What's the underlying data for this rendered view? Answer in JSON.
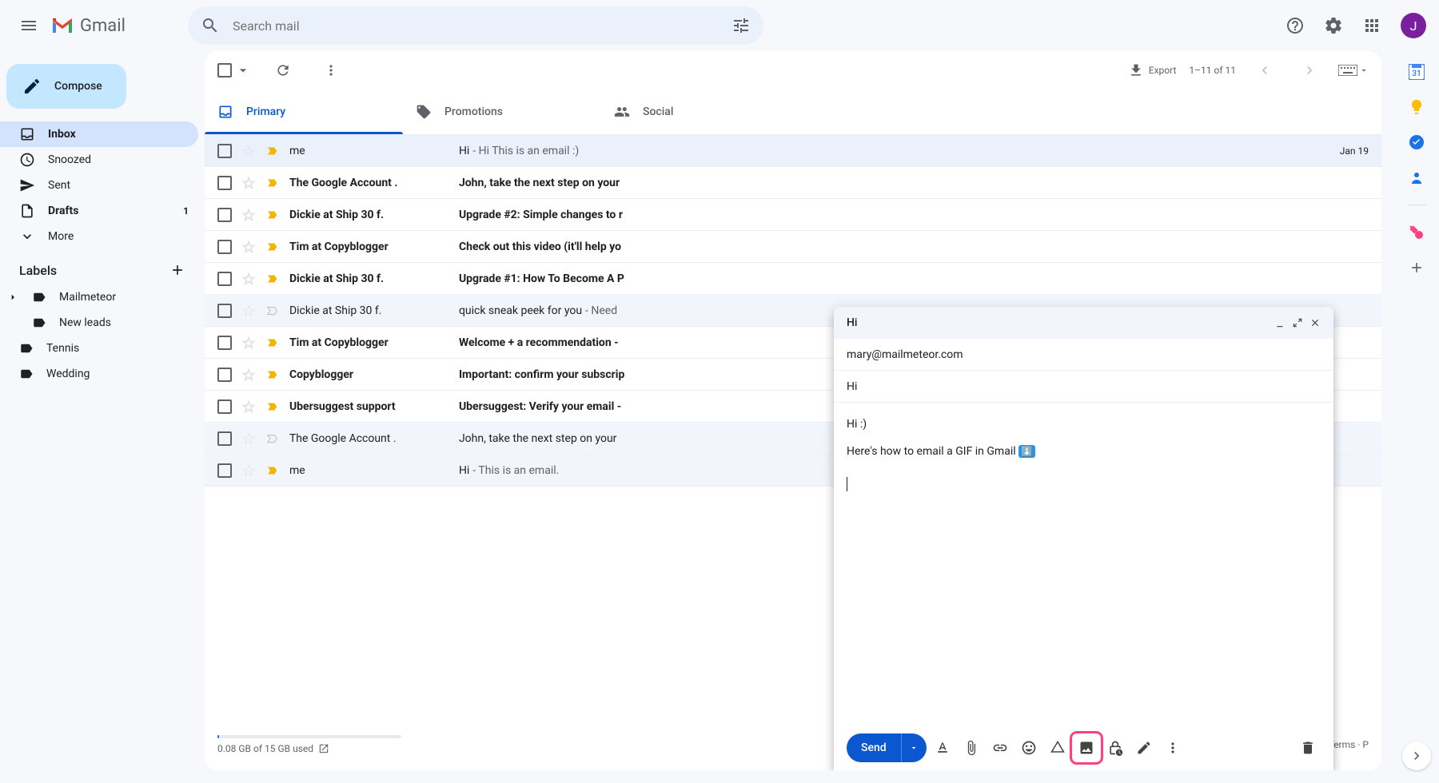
{
  "app": {
    "name": "Gmail",
    "avatar_initial": "J"
  },
  "search": {
    "placeholder": "Search mail"
  },
  "compose_button": "Compose",
  "sidebar": {
    "items": [
      {
        "label": "Inbox",
        "icon": "inbox",
        "active": true,
        "bold": true
      },
      {
        "label": "Snoozed",
        "icon": "clock"
      },
      {
        "label": "Sent",
        "icon": "send"
      },
      {
        "label": "Drafts",
        "icon": "file",
        "bold": true,
        "count": "1"
      },
      {
        "label": "More",
        "icon": "chevron-down"
      }
    ],
    "labels_header": "Labels",
    "labels": [
      {
        "label": "Mailmeteor",
        "expandable": true
      },
      {
        "label": "New leads",
        "child": true
      },
      {
        "label": "Tennis"
      },
      {
        "label": "Wedding"
      }
    ]
  },
  "toolbar": {
    "export": "Export",
    "pagination": "1–11 of 11"
  },
  "tabs": [
    {
      "label": "Primary",
      "active": true
    },
    {
      "label": "Promotions"
    },
    {
      "label": "Social"
    }
  ],
  "emails": [
    {
      "sender": "me",
      "subject": "Hi",
      "snippet": " - Hi This is an email :)",
      "date": "Jan 19",
      "important": true,
      "unread": false
    },
    {
      "sender": "The Google Account .",
      "subject": "John, take the next step on your",
      "snippet": "",
      "date": "",
      "important": true,
      "unread": true
    },
    {
      "sender": "Dickie at Ship 30 f.",
      "subject": "Upgrade #2: Simple changes to r",
      "snippet": "",
      "date": "",
      "important": true,
      "unread": true
    },
    {
      "sender": "Tim at Copyblogger",
      "subject": "Check out this video (it'll help yo",
      "snippet": "",
      "date": "",
      "important": true,
      "unread": true
    },
    {
      "sender": "Dickie at Ship 30 f.",
      "subject": "Upgrade #1: How To Become A P",
      "snippet": "",
      "date": "",
      "important": true,
      "unread": true
    },
    {
      "sender": "Dickie at Ship 30 f.",
      "subject": "quick sneak peek for you",
      "snippet": " - Need",
      "date": "",
      "important": false,
      "unread": false
    },
    {
      "sender": "Tim at Copyblogger",
      "subject": "Welcome + a recommendation -",
      "snippet": "",
      "date": "",
      "important": true,
      "unread": true
    },
    {
      "sender": "Copyblogger",
      "subject": "Important: confirm your subscrip",
      "snippet": "",
      "date": "",
      "important": true,
      "unread": true
    },
    {
      "sender": "Ubersuggest support",
      "subject": "Ubersuggest: Verify your email -",
      "snippet": "",
      "date": "",
      "important": true,
      "unread": true
    },
    {
      "sender": "The Google Account .",
      "subject": "John, take the next step on your",
      "snippet": "",
      "date": "",
      "important": false,
      "unread": false
    },
    {
      "sender": "me",
      "subject": "Hi",
      "snippet": " - This is an email.",
      "date": "",
      "important": true,
      "unread": false
    }
  ],
  "footer": {
    "storage": "0.08 GB of 15 GB used",
    "terms": "Terms · P"
  },
  "compose": {
    "title": "Hi",
    "to": "mary@mailmeteor.com",
    "subject": "Hi",
    "body_line1": "Hi :)",
    "body_line2": "Here's how to email a GIF in Gmail",
    "gif_emoji": "⬇️",
    "send": "Send"
  },
  "side_apps": [
    {
      "name": "calendar",
      "color": "#4285f4"
    },
    {
      "name": "keep",
      "color": "#fbbc04"
    },
    {
      "name": "tasks",
      "color": "#1a73e8"
    },
    {
      "name": "contacts",
      "color": "#1a73e8"
    },
    {
      "name": "meteor",
      "color": "#ff4081"
    }
  ]
}
